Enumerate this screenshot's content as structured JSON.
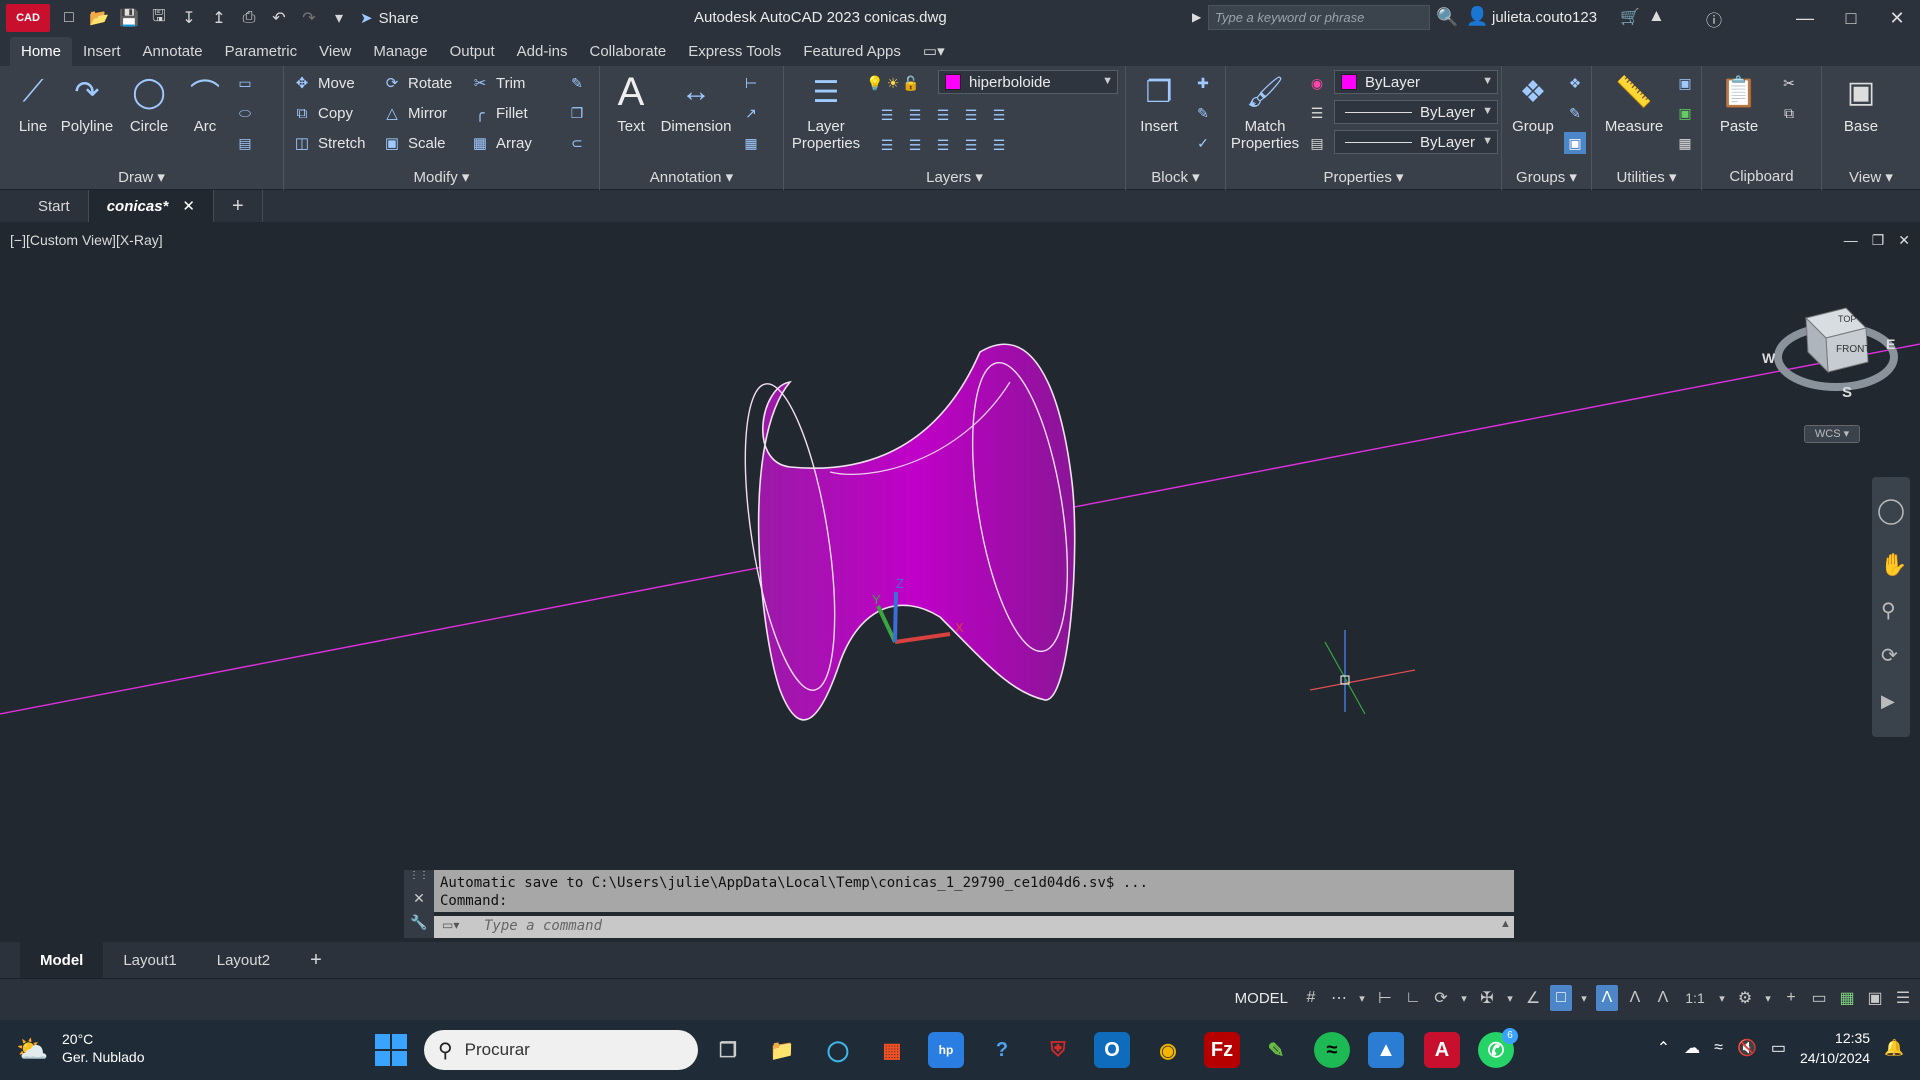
{
  "titlebar": {
    "logo": "CAD",
    "share": "Share",
    "title": "Autodesk AutoCAD 2023    conicas.dwg",
    "search_placeholder": "Type a keyword or phrase",
    "user": "julieta.couto123"
  },
  "ribbon_tabs": [
    "Home",
    "Insert",
    "Annotate",
    "Parametric",
    "View",
    "Manage",
    "Output",
    "Add-ins",
    "Collaborate",
    "Express Tools",
    "Featured Apps"
  ],
  "ribbon": {
    "draw": {
      "title": "Draw",
      "line": "Line",
      "polyline": "Polyline",
      "circle": "Circle",
      "arc": "Arc"
    },
    "modify": {
      "title": "Modify",
      "move": "Move",
      "rotate": "Rotate",
      "trim": "Trim",
      "copy": "Copy",
      "mirror": "Mirror",
      "fillet": "Fillet",
      "stretch": "Stretch",
      "scale": "Scale",
      "array": "Array"
    },
    "annotation": {
      "title": "Annotation",
      "text": "Text",
      "dimension": "Dimension"
    },
    "layers": {
      "title": "Layers",
      "layer_properties_1": "Layer",
      "layer_properties_2": "Properties",
      "current_layer": "hiperboloide"
    },
    "block": {
      "title": "Block",
      "insert": "Insert"
    },
    "properties": {
      "title": "Properties",
      "match_1": "Match",
      "match_2": "Properties",
      "color": "ByLayer",
      "linetype": "ByLayer",
      "lineweight": "ByLayer"
    },
    "groups": {
      "title": "Groups",
      "group": "Group"
    },
    "utilities": {
      "title": "Utilities",
      "measure": "Measure"
    },
    "clipboard": {
      "title": "Clipboard",
      "paste": "Paste"
    },
    "view": {
      "title": "View",
      "base": "Base"
    }
  },
  "file_tabs": {
    "start": "Start",
    "current": "conicas*"
  },
  "viewport": {
    "label": "[−][Custom View][X-Ray]",
    "viewcube_top": "TOP",
    "viewcube_front": "FRONT",
    "compass_w": "W",
    "compass_e": "E",
    "compass_s": "S",
    "wcs": "WCS"
  },
  "command": {
    "history_1": "Automatic save to C:\\Users\\julie\\AppData\\Local\\Temp\\conicas_1_29790_ce1d04d6.sv$ ...",
    "history_2": "Command:",
    "placeholder": "Type a command"
  },
  "layout_tabs": [
    "Model",
    "Layout1",
    "Layout2"
  ],
  "status": {
    "model": "MODEL",
    "scale": "1:1"
  },
  "taskbar": {
    "temp": "20°C",
    "weather": "Ger. Nublado",
    "search": "Procurar",
    "time": "12:35",
    "date": "24/10/2024",
    "whatsapp_badge": "6"
  },
  "colors": {
    "accent": "#ff00ff",
    "ribbon_bg": "#394049",
    "viewport_bg": "#212830"
  }
}
